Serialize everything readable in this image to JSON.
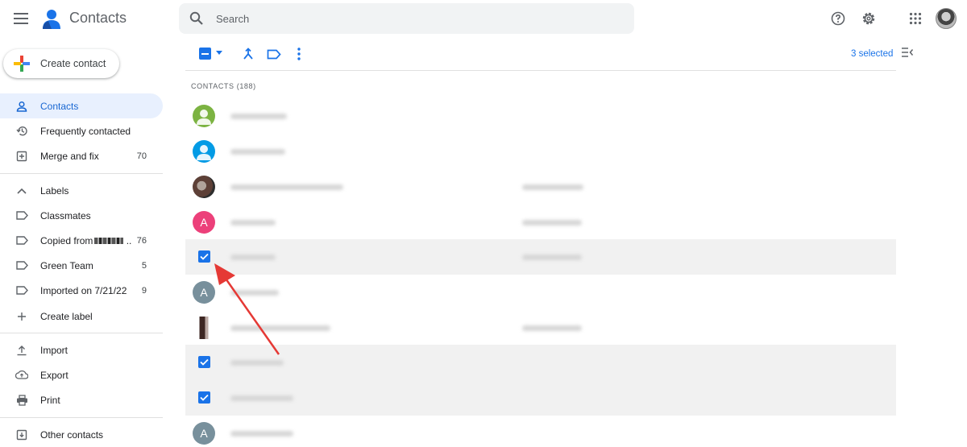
{
  "header": {
    "title": "Contacts",
    "search_placeholder": "Search",
    "icons": [
      "menu-icon",
      "search-icon",
      "help-icon",
      "settings-icon",
      "apps-icon",
      "account-avatar"
    ]
  },
  "sidebar": {
    "create_label": "Create contact",
    "items": [
      {
        "label": "Contacts",
        "icon": "person-icon",
        "count": ""
      },
      {
        "label": "Frequently contacted",
        "icon": "history-icon",
        "count": ""
      },
      {
        "label": "Merge and fix",
        "icon": "merge-icon",
        "count": "70"
      }
    ],
    "labels_header": "Labels",
    "labels": [
      {
        "label": "Classmates",
        "count": ""
      },
      {
        "label": "Copied from",
        "suffix": "..",
        "count": "76"
      },
      {
        "label": "Green Team",
        "count": "5"
      },
      {
        "label": "Imported on 7/21/22",
        "count": "9"
      }
    ],
    "create_label_text": "Create label",
    "actions": [
      {
        "label": "Import",
        "icon": "import-icon"
      },
      {
        "label": "Export",
        "icon": "export-icon"
      },
      {
        "label": "Print",
        "icon": "print-icon"
      }
    ],
    "other_contacts": "Other contacts"
  },
  "toolbar": {
    "selected_text": "3 selected"
  },
  "list": {
    "section_title": "CONTACTS (188)",
    "rows": [
      {
        "type": "avatar",
        "color": "#7cb342",
        "letter": "",
        "selected": false
      },
      {
        "type": "avatar",
        "color": "#039be5",
        "letter": "",
        "selected": false
      },
      {
        "type": "photo",
        "color": "#6d4c41",
        "letter": "",
        "selected": false
      },
      {
        "type": "avatar",
        "color": "#ec407a",
        "letter": "A",
        "selected": false
      },
      {
        "type": "checkbox",
        "color": "",
        "letter": "",
        "selected": true
      },
      {
        "type": "avatar",
        "color": "#78909c",
        "letter": "A",
        "selected": false
      },
      {
        "type": "photo",
        "color": "#3e2723",
        "letter": "",
        "selected": false
      },
      {
        "type": "checkbox",
        "color": "",
        "letter": "",
        "selected": true
      },
      {
        "type": "checkbox",
        "color": "",
        "letter": "",
        "selected": true
      },
      {
        "type": "avatar",
        "color": "#78909c",
        "letter": "A",
        "selected": false
      }
    ]
  },
  "colors": {
    "accent": "#1a73e8",
    "active_bg": "#e8f0fe",
    "annotation_arrow": "#e53935"
  }
}
